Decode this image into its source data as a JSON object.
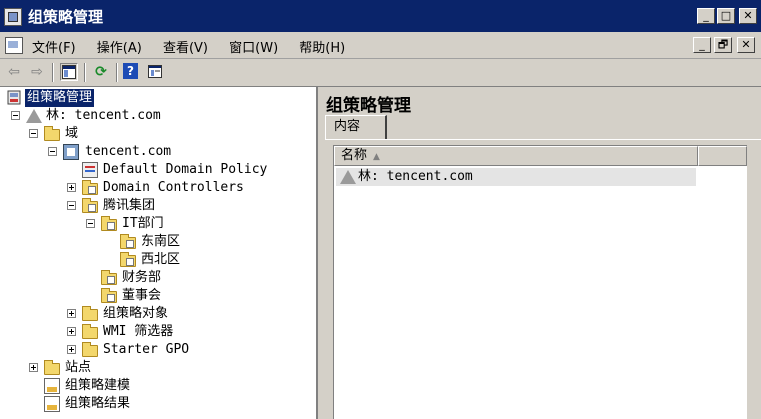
{
  "window": {
    "title": "组策略管理",
    "caption_buttons": [
      "_",
      "□",
      "✕"
    ]
  },
  "menubar": {
    "items": [
      "文件(F)",
      "操作(A)",
      "查看(V)",
      "窗口(W)",
      "帮助(H)"
    ],
    "mdi_buttons": [
      "_",
      "🗗",
      "✕"
    ]
  },
  "toolbar": {
    "buttons": [
      "back-icon",
      "forward-icon",
      "show-hide-tree-icon",
      "refresh-icon",
      "help-icon",
      "properties-icon"
    ],
    "back": "⇦",
    "forward": "⇨",
    "refresh": "⟳",
    "help": "?"
  },
  "tree": {
    "root": "组策略管理",
    "forest": "林: tencent.com",
    "domains": "域",
    "domain": "tencent.com",
    "default_policy": "Default Domain Policy",
    "domain_controllers": "Domain Controllers",
    "ou_tencent": "腾讯集团",
    "ou_it": "IT部门",
    "ou_southeast": "东南区",
    "ou_northwest": "西北区",
    "ou_finance": "财务部",
    "ou_board": "董事会",
    "gpo_objects": "组策略对象",
    "wmi_filters": "WMI 筛选器",
    "starter_gpo": "Starter GPO",
    "sites": "站点",
    "modeling": "组策略建模",
    "results": "组策略结果"
  },
  "right_pane": {
    "title": "组策略管理",
    "tab": "内容",
    "column_name": "名称",
    "sort_arrow": "▲",
    "rows": [
      "林: tencent.com"
    ]
  },
  "colors": {
    "titlebar": "#0a246a",
    "chrome": "#d4d0c8",
    "selection": "#0a246a",
    "folder": "#f3d76c"
  }
}
